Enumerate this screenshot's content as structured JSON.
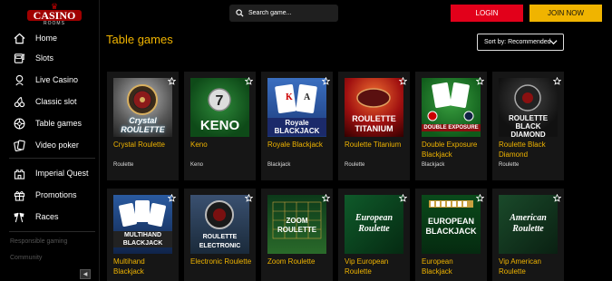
{
  "logo": {
    "brand": "CASINO",
    "sub": "ROOMS"
  },
  "sidebar": {
    "items": [
      {
        "label": "Home",
        "icon": "home-icon"
      },
      {
        "label": "Slots",
        "icon": "slot-machine-icon"
      },
      {
        "label": "Live Casino",
        "icon": "live-casino-icon"
      },
      {
        "label": "Classic slot",
        "icon": "cherry-icon"
      },
      {
        "label": "Table games",
        "icon": "roulette-icon"
      },
      {
        "label": "Video poker",
        "icon": "cards-icon"
      },
      {
        "label": "Imperial Quest",
        "icon": "castle-icon"
      },
      {
        "label": "Promotions",
        "icon": "gift-icon"
      },
      {
        "label": "Races",
        "icon": "race-flags-icon"
      }
    ],
    "footer": [
      "Responsible gaming",
      "Community"
    ]
  },
  "header": {
    "search_placeholder": "Search game...",
    "login_label": "LOGIN",
    "join_label": "JOIN NOW"
  },
  "main": {
    "title": "Table games",
    "sort_label": "Sort by: Recommended"
  },
  "games": [
    {
      "name": "Crystal Roulette",
      "category": "Roulette",
      "thumb_text": "Crystal ROULETTE"
    },
    {
      "name": "Keno",
      "category": "Keno",
      "thumb_text": "KENO"
    },
    {
      "name": "Royale Blackjack",
      "category": "Blackjack",
      "thumb_text": "Royale BLACKJACK"
    },
    {
      "name": "Roulette Titanium",
      "category": "Roulette",
      "thumb_text": "ROULETTE TITANIUM"
    },
    {
      "name": "Double Exposure Blackjack",
      "category": "Blackjack",
      "thumb_text": "DOUBLE EXPOSURE"
    },
    {
      "name": "Roulette Black Diamond",
      "category": "Roulette",
      "thumb_text": "ROULETTE BLACK DIAMOND"
    },
    {
      "name": "Multihand Blackjack",
      "category": "",
      "thumb_text": "MULTIHAND BLACKJACK"
    },
    {
      "name": "Electronic Roulette",
      "category": "",
      "thumb_text": "ROULETTE ELECTRONIC"
    },
    {
      "name": "Zoom Roulette",
      "category": "",
      "thumb_text": "ZOOM ROULETTE"
    },
    {
      "name": "Vip European Roulette",
      "category": "",
      "thumb_text": "European Roulette"
    },
    {
      "name": "European Blackjack",
      "category": "",
      "thumb_text": "EUROPEAN BLACKJACK"
    },
    {
      "name": "Vip American Roulette",
      "category": "",
      "thumb_text": "American Roulette"
    }
  ],
  "colors": {
    "accent": "#f0b400",
    "login": "#e2001a",
    "join": "#f0b400",
    "card_bg": "#161616"
  }
}
